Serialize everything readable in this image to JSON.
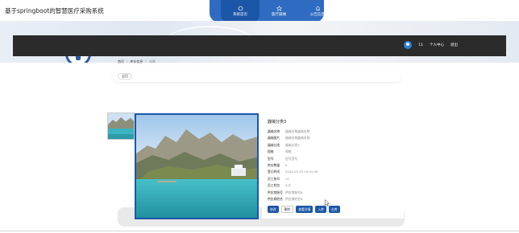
{
  "app": {
    "title": "基于springboot的智慧医疗采购系统"
  },
  "nav": {
    "items": [
      {
        "label": "系统首页",
        "icon": "home-icon",
        "active": true
      },
      {
        "label": "医疗器械",
        "icon": "star-icon",
        "active": false
      },
      {
        "label": "公告信息",
        "icon": "bell-icon",
        "active": false
      }
    ]
  },
  "user": {
    "name": "11",
    "center_label": "个人中心",
    "logout_label": "退出"
  },
  "breadcrumb": {
    "home": "首页",
    "section": "库存信息",
    "current": "详情"
  },
  "back": {
    "label": "返回"
  },
  "detail": {
    "title": "器械分类3",
    "fields": [
      {
        "key": "器械名称",
        "value": "器械名称器械名称"
      },
      {
        "key": "器械图片",
        "value": "器械名称器械名称"
      },
      {
        "key": "器械分类",
        "value": "器械分类3"
      },
      {
        "key": "规格",
        "value": "规格"
      },
      {
        "key": "型号",
        "value": "型号型号"
      },
      {
        "key": "库存数量",
        "value": "0"
      },
      {
        "key": "登记时间",
        "value": "2024-05-25 10:51:00"
      },
      {
        "key": "员工账号",
        "value": "11"
      },
      {
        "key": "员工姓名",
        "value": "小小"
      },
      {
        "key": "供应商账号",
        "value": "供应商账号8"
      },
      {
        "key": "供应商姓名",
        "value": "供应商姓名8"
      }
    ],
    "actions": [
      {
        "label": "修改",
        "style": "primary"
      },
      {
        "label": "删除",
        "style": "light"
      },
      {
        "label": "查看详情",
        "style": "primary"
      },
      {
        "label": "入库",
        "style": "primary"
      },
      {
        "label": "出库",
        "style": "primary"
      }
    ]
  },
  "colors": {
    "accent": "#1c56a8",
    "navbar": "#2f6bc0",
    "darkbar": "#2b2b2b"
  }
}
